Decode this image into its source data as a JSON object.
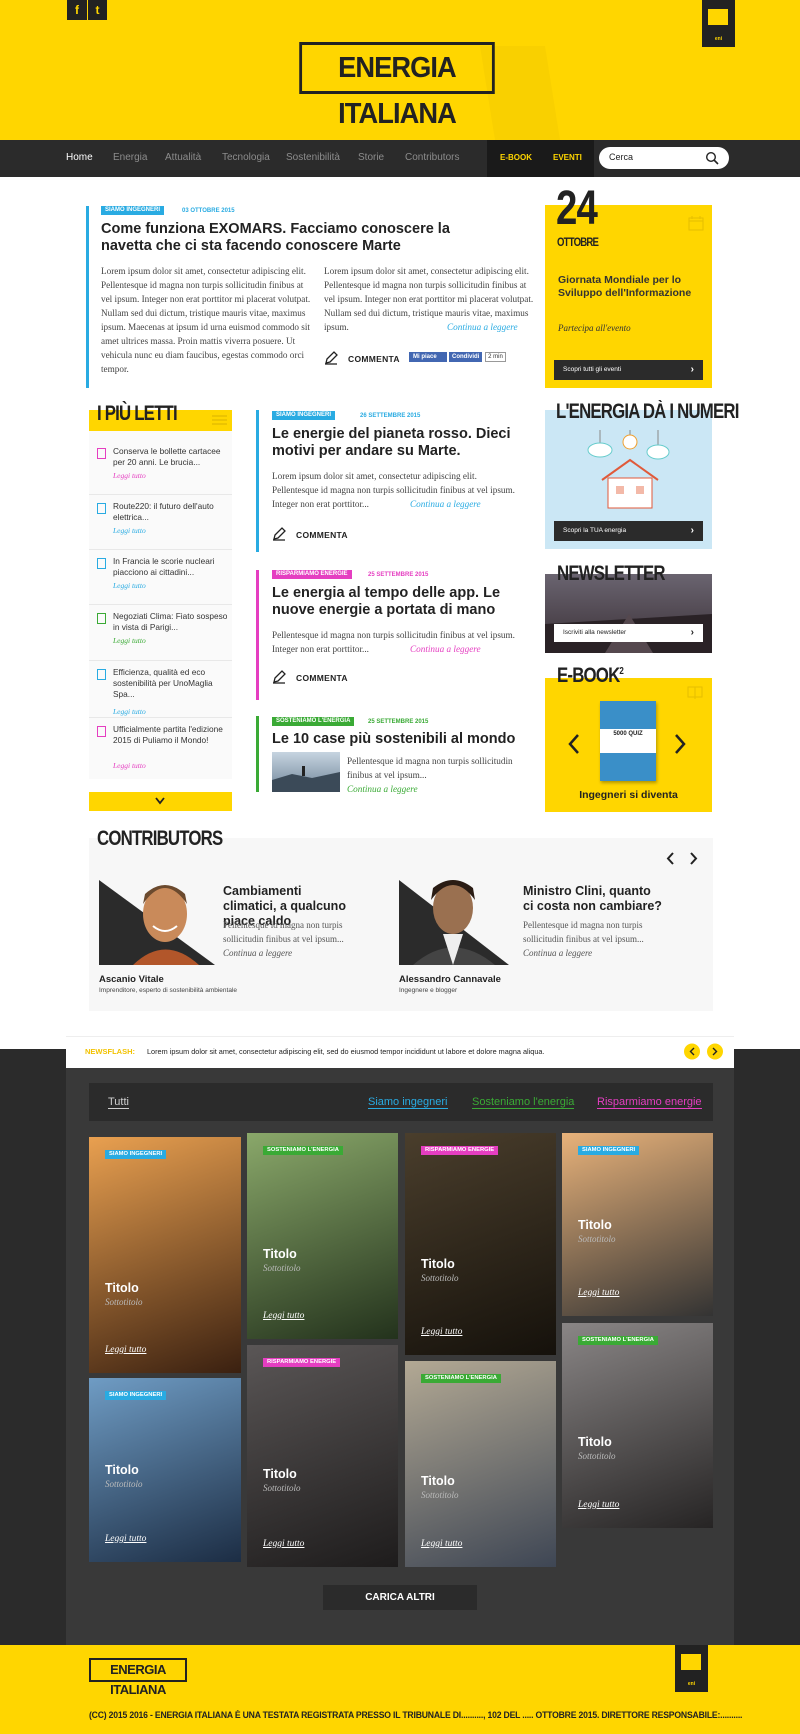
{
  "header": {
    "social": [
      "f",
      "t"
    ],
    "logo": "ENERGIA ITALIANA",
    "badge_text": "eni"
  },
  "nav": {
    "items": [
      "Home",
      "Energia",
      "Attualità",
      "Tecnologia",
      "Sostenibilità",
      "Storie",
      "Contributors"
    ],
    "ebook": "E-BOOK",
    "eventi": "EVENTI",
    "search_value": "Cerca"
  },
  "featured": {
    "tag": "SIAMO INGEGNERI",
    "date": "03 OTTOBRE 2015",
    "title": "Come funziona EXOMARS. Facciamo conoscere la navetta che ci sta facendo conoscere Marte",
    "col1": "Lorem ipsum dolor sit amet, consectetur adipiscing elit. Pellentesque id magna non turpis sollicitudin finibus at vel ipsum. Integer non erat porttitor mi placerat volutpat. Nullam sed dui dictum, tristique mauris vitae, maximus ipsum. Maecenas at ipsum id urna euismod commodo sit amet ultrices massa. Proin mattis viverra posuere. Ut vehicula nunc eu diam faucibus, egestas commodo orci tempor.",
    "col2": "Lorem ipsum dolor sit amet, consectetur adipiscing elit. Pellentesque id magna non turpis sollicitudin finibus at vel ipsum. Integer non erat porttitor mi placerat volutpat. Nullam sed dui dictum, tristique mauris vitae, maximus ipsum.",
    "more": "Continua a leggere",
    "comment": "COMMENTA",
    "like": "Mi piace",
    "share": "Condividi",
    "count": "2 min"
  },
  "event": {
    "day": "24",
    "month": "OTTOBRE",
    "title": "Giornata Mondiale per lo Sviluppo dell'Informazione",
    "cta": "Partecipa all'evento",
    "button": "Scopri tutti gli eventi"
  },
  "most_read": {
    "title": "I PIÙ LETTI",
    "items": [
      {
        "text": "Conserva le bollette cartacee per 20 anni. Le brucia...",
        "link": "Leggi tutto",
        "color": "#e53ec1"
      },
      {
        "text": "Route220: il futuro dell'auto elettrica...",
        "link": "Leggi tutto",
        "color": "#29abe2"
      },
      {
        "text": "In Francia le scorie nucleari piacciono ai cittadini...",
        "link": "Leggi tutto",
        "color": "#29abe2"
      },
      {
        "text": "Negoziati Clima: Fiato sospeso in vista di Parigi...",
        "link": "Leggi tutto",
        "color": "#3aaa35"
      },
      {
        "text": "Efficienza, qualità ed eco sostenibilità per UnoMaglia Spa...",
        "link": "Leggi tutto",
        "color": "#29abe2"
      },
      {
        "text": "Ufficialmente partita l'edizione 2015 di Puliamo il Mondo!",
        "link": "Leggi tutto",
        "color": "#e53ec1"
      }
    ]
  },
  "articles": [
    {
      "tag": "SIAMO INGEGNERI",
      "date": "26 SETTEMBRE 2015",
      "title": "Le energie del pianeta rosso. Dieci motivi per andare su Marte.",
      "body": "Lorem ipsum dolor sit amet, consectetur adipiscing elit. Pellentesque id magna non turpis sollicitudin finibus at vel ipsum. Integer non erat porttitor...",
      "more": "Continua a leggere",
      "comment": "COMMENTA",
      "color": "#29abe2"
    },
    {
      "tag": "RISPARMIAMO ENERGIE",
      "date": "25 SETTEMBRE 2015",
      "title": "Le energia al tempo delle app. Le nuove energie a portata di mano",
      "body": "Pellentesque id magna non turpis sollicitudin finibus at vel ipsum. Integer non erat porttitor...",
      "more": "Continua a leggere",
      "comment": "COMMENTA",
      "color": "#e53ec1"
    },
    {
      "tag": "SOSTENIAMO L'ENERGIA",
      "date": "25 SETTEMBRE 2015",
      "title": "Le 10 case più sostenibili al mondo",
      "body": "Pellentesque id magna non turpis sollicitudin finibus at vel ipsum...",
      "more": "Continua a leggere",
      "color": "#3aaa35"
    }
  ],
  "numbers": {
    "title": "L'ENERGIA DÀ I NUMERI",
    "button": "Scopri la TUA energia"
  },
  "newsletter": {
    "title": "NEWSLETTER",
    "button": "Iscriviti alla newsletter"
  },
  "ebook": {
    "title": "E-BOOK",
    "sup": "2",
    "book_text": "5000 QUIZ",
    "caption": "Ingegneri si diventa"
  },
  "contributors": {
    "title": "CONTRIBUTORS",
    "items": [
      {
        "headline": "Cambiamenti climatici, a qualcuno piace caldo",
        "body": "Pellentesque id magna non turpis sollicitudin finibus at vel ipsum...",
        "more": "Continua a leggere",
        "name": "Ascanio Vitale",
        "role": "Imprenditore, esperto di sostenibilità ambientale"
      },
      {
        "headline": "Ministro Clini, quanto ci costa non cambiare?",
        "body": "Pellentesque id magna non turpis sollicitudin finibus at vel ipsum...",
        "more": "Continua a leggere",
        "name": "Alessandro Cannavale",
        "role": "Ingegnere e blogger"
      }
    ]
  },
  "newsflash": {
    "label": "NEWSFLASH:",
    "text": "Lorem ipsum dolor sit amet, consectetur adipiscing elit, sed do eiusmod tempor incididunt ut labore et dolore magna aliqua."
  },
  "filters": [
    {
      "label": "Tutti",
      "color": "#cfcfcf"
    },
    {
      "label": "Siamo ingegneri",
      "color": "#29abe2"
    },
    {
      "label": "Sosteniamo l'energia",
      "color": "#3aaa35"
    },
    {
      "label": "Risparmiamo energie",
      "color": "#e53ec1"
    }
  ],
  "tiles": [
    {
      "tag": "SIAMO INGEGNERI",
      "title": "Titolo",
      "sub": "Sottotitolo",
      "link": "Leggi tutto"
    },
    {
      "tag": "SIAMO INGEGNERI",
      "title": "Titolo",
      "sub": "Sottotitolo",
      "link": "Leggi tutto"
    },
    {
      "tag": "SOSTENIAMO L'ENERGIA",
      "title": "Titolo",
      "sub": "Sottotitolo",
      "link": "Leggi tutto"
    },
    {
      "tag": "RISPARMIAMO ENERGIE",
      "title": "Titolo",
      "sub": "Sottotitolo",
      "link": "Leggi tutto"
    },
    {
      "tag": "RISPARMIAMO ENERGIE",
      "title": "Titolo",
      "sub": "Sottotitolo",
      "link": "Leggi tutto"
    },
    {
      "tag": "SOSTENIAMO L'ENERGIA",
      "title": "Titolo",
      "sub": "Sottotitolo",
      "link": "Leggi tutto"
    },
    {
      "tag": "SIAMO INGEGNERI",
      "title": "Titolo",
      "sub": "Sottotitolo",
      "link": "Leggi tutto"
    },
    {
      "tag": "SOSTENIAMO L'ENERGIA",
      "title": "Titolo",
      "sub": "Sottotitolo",
      "link": "Leggi tutto"
    }
  ],
  "load_more": "CARICA ALTRI",
  "footer": {
    "logo": "ENERGIA ITALIANA",
    "copyright": "(CC) 2015 2016 - ENERGIA ITALIANA È UNA TESTATA REGISTRATA PRESSO IL TRIBUNALE DI.........., 102 DEL ..... OTTOBRE 2015. DIRETTORE RESPONSABILE:.........."
  }
}
